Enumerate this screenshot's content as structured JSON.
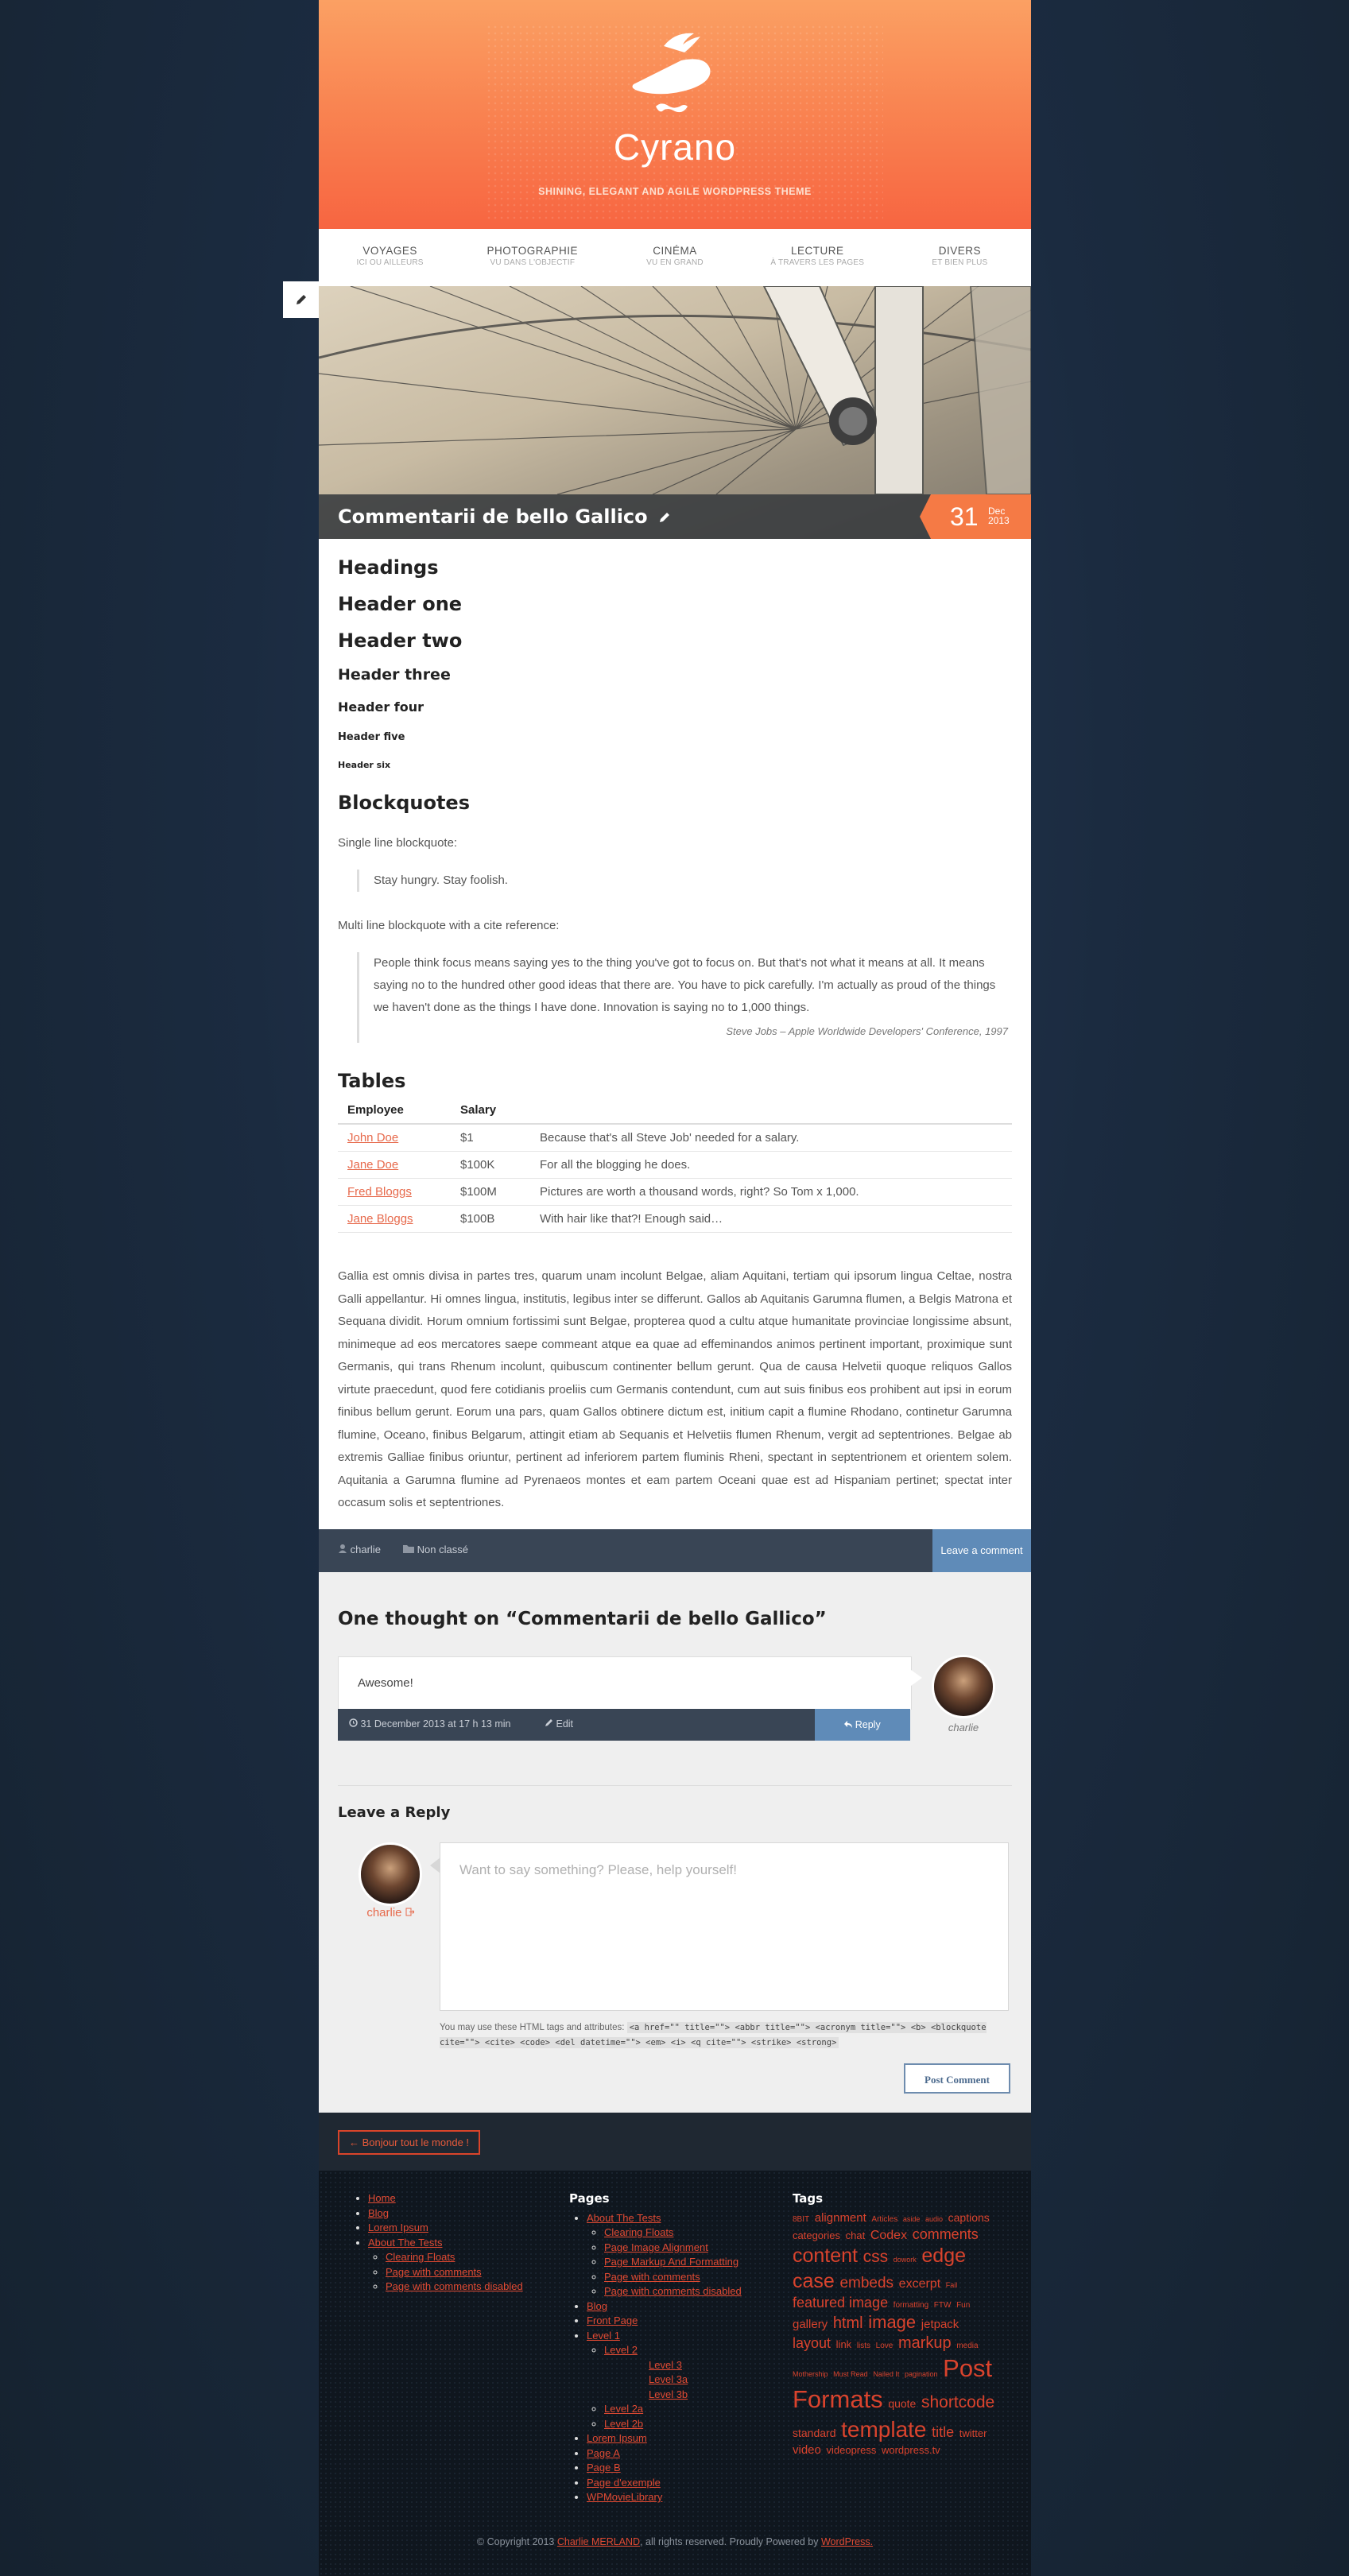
{
  "site": {
    "title": "Cyrano",
    "tagline": "SHINING, ELEGANT AND AGILE WORDPRESS THEME"
  },
  "nav": [
    {
      "label": "VOYAGES",
      "sub": "ICI OU AILLEURS"
    },
    {
      "label": "PHOTOGRAPHIE",
      "sub": "VU DANS L'OBJECTIF"
    },
    {
      "label": "CINÉMA",
      "sub": "VU EN GRAND"
    },
    {
      "label": "LECTURE",
      "sub": "À TRAVERS LES PAGES"
    },
    {
      "label": "DIVERS",
      "sub": "ET BIEN PLUS"
    }
  ],
  "post": {
    "title": "Commentarii de bello Gallico",
    "date_day": "31",
    "date_month": "Dec",
    "date_year": "2013",
    "headings": {
      "headings": "Headings",
      "h1": "Header one",
      "h2": "Header two",
      "h3": "Header three",
      "h4": "Header four",
      "h5": "Header five",
      "h6": "Header six"
    },
    "blockquotes_title": "Blockquotes",
    "single_label": "Single line blockquote:",
    "single_quote": "Stay hungry. Stay foolish.",
    "multi_label": "Multi line blockquote with a cite reference:",
    "multi_quote": "People think focus means saying yes to the thing you've got to focus on. But that's not what it means at all. It means saying no to the hundred other good ideas that there are. You have to pick carefully. I'm actually as proud of the things we haven't done as the things I have done. Innovation is saying no to 1,000 things.",
    "multi_cite": "Steve Jobs – Apple Worldwide Developers' Conference, 1997",
    "tables_title": "Tables",
    "table": {
      "headers": [
        "Employee",
        "Salary",
        ""
      ],
      "rows": [
        [
          "John Doe",
          "$1",
          "Because that's all Steve Job' needed for a salary."
        ],
        [
          "Jane Doe",
          "$100K",
          "For all the blogging he does."
        ],
        [
          "Fred Bloggs",
          "$100M",
          "Pictures are worth a thousand words, right? So Tom x 1,000."
        ],
        [
          "Jane Bloggs",
          "$100B",
          "With hair like that?! Enough said…"
        ]
      ]
    },
    "lorem": "Gallia est omnis divisa in partes tres, quarum unam incolunt Belgae, aliam Aquitani, tertiam qui ipsorum lingua Celtae, nostra Galli appellantur. Hi omnes lingua, institutis, legibus inter se differunt. Gallos ab Aquitanis Garumna flumen, a Belgis Matrona et Sequana dividit. Horum omnium fortissimi sunt Belgae, propterea quod a cultu atque humanitate provinciae longissime absunt, minimeque ad eos mercatores saepe commeant atque ea quae ad effeminandos animos pertinent important, proximique sunt Germanis, qui trans Rhenum incolunt, quibuscum continenter bellum gerunt. Qua de causa Helvetii quoque reliquos Gallos virtute praecedunt, quod fere cotidianis proeliis cum Germanis contendunt, cum aut suis finibus eos prohibent aut ipsi in eorum finibus bellum gerunt. Eorum una pars, quam Gallos obtinere dictum est, initium capit a flumine Rhodano, continetur Garumna flumine, Oceano, finibus Belgarum, attingit etiam ab Sequanis et Helvetiis flumen Rhenum, vergit ad septentriones. Belgae ab extremis Galliae finibus oriuntur, pertinent ad inferiorem partem fluminis Rheni, spectant in septentrionem et orientem solem. Aquitania a Garumna flumine ad Pyrenaeos montes et eam partem Oceani quae est ad Hispaniam pertinet; spectat inter occasum solis et septentriones."
  },
  "meta": {
    "author": "charlie",
    "category": "Non classé",
    "leave_comment": "Leave a comment"
  },
  "comments": {
    "title": "One thought on “Commentarii de bello Gallico”",
    "items": [
      {
        "text": "Awesome!",
        "date": "31 December 2013 at 17 h 13 min",
        "edit": "Edit",
        "reply": "Reply",
        "author": "charlie"
      }
    ],
    "leave_reply": "Leave a Reply",
    "user": "charlie",
    "placeholder": "Want to say something? Please, help yourself!",
    "allowed_intro": "You may use these HTML tags and attributes:",
    "allowed_code": "<a href=\"\" title=\"\"> <abbr title=\"\"> <acronym title=\"\"> <b> <blockquote cite=\"\"> <cite> <code> <del datetime=\"\"> <em> <i> <q cite=\"\"> <strike> <strong>",
    "submit": "Post Comment"
  },
  "prev_link": "← Bonjour tout le monde !",
  "footer": {
    "col1": [
      "Home",
      "Blog",
      "Lorem Ipsum",
      "About The Tests"
    ],
    "col1_sub": [
      "Clearing Floats",
      "Page with comments",
      "Page with comments disabled"
    ],
    "pages_title": "Pages",
    "pages_top": [
      "About The Tests"
    ],
    "pages_sub": [
      "Clearing Floats",
      "Page Image Alignment",
      "Page Markup And Formatting",
      "Page with comments",
      "Page with comments disabled"
    ],
    "pages_mid": [
      "Blog",
      "Front Page",
      "Level 1"
    ],
    "level2": "Level 2",
    "level3": [
      "Level 3",
      "Level 3a",
      "Level 3b"
    ],
    "level2_rest": [
      "Level 2a",
      "Level 2b"
    ],
    "pages_end": [
      "Lorem Ipsum",
      "Page A",
      "Page B",
      "Page d'exemple",
      "WPMovieLibrary"
    ],
    "tags_title": "Tags",
    "tags": [
      {
        "t": "8BIT",
        "s": 10
      },
      {
        "t": "alignment",
        "s": 15
      },
      {
        "t": "Articles",
        "s": 10
      },
      {
        "t": "aside",
        "s": 9
      },
      {
        "t": "audio",
        "s": 9
      },
      {
        "t": "captions",
        "s": 14
      },
      {
        "t": "categories",
        "s": 13
      },
      {
        "t": "chat",
        "s": 13
      },
      {
        "t": "Codex",
        "s": 16
      },
      {
        "t": "comments",
        "s": 18
      },
      {
        "t": "content",
        "s": 25
      },
      {
        "t": "css",
        "s": 21
      },
      {
        "t": "dowork",
        "s": 9
      },
      {
        "t": "edge case",
        "s": 25
      },
      {
        "t": "embeds",
        "s": 19
      },
      {
        "t": "excerpt",
        "s": 16
      },
      {
        "t": "Fail",
        "s": 9
      },
      {
        "t": "featured image",
        "s": 18
      },
      {
        "t": "formatting",
        "s": 10
      },
      {
        "t": "FTW",
        "s": 10
      },
      {
        "t": "Fun",
        "s": 10
      },
      {
        "t": "gallery",
        "s": 15
      },
      {
        "t": "html",
        "s": 20
      },
      {
        "t": "image",
        "s": 22
      },
      {
        "t": "jetpack",
        "s": 15
      },
      {
        "t": "layout",
        "s": 18
      },
      {
        "t": "link",
        "s": 13
      },
      {
        "t": "lists",
        "s": 10
      },
      {
        "t": "Love",
        "s": 10
      },
      {
        "t": "markup",
        "s": 20
      },
      {
        "t": "media",
        "s": 10
      },
      {
        "t": "Mothership",
        "s": 9
      },
      {
        "t": "Must Read",
        "s": 9
      },
      {
        "t": "Nailed It",
        "s": 9
      },
      {
        "t": "pagination",
        "s": 9
      },
      {
        "t": "Post Formats",
        "s": 31
      },
      {
        "t": "quote",
        "s": 14
      },
      {
        "t": "shortcode",
        "s": 21
      },
      {
        "t": "standard",
        "s": 14
      },
      {
        "t": "template",
        "s": 28
      },
      {
        "t": "title",
        "s": 18
      },
      {
        "t": "twitter",
        "s": 13
      },
      {
        "t": "video",
        "s": 15
      },
      {
        "t": "videopress",
        "s": 13
      },
      {
        "t": "wordpress.tv",
        "s": 13
      }
    ],
    "copyright_pre": "© Copyright 2013",
    "copyright_name": "Charlie MERLAND",
    "copyright_mid": ", all rights reserved. Proudly Powered by",
    "copyright_wp": "WordPress."
  }
}
